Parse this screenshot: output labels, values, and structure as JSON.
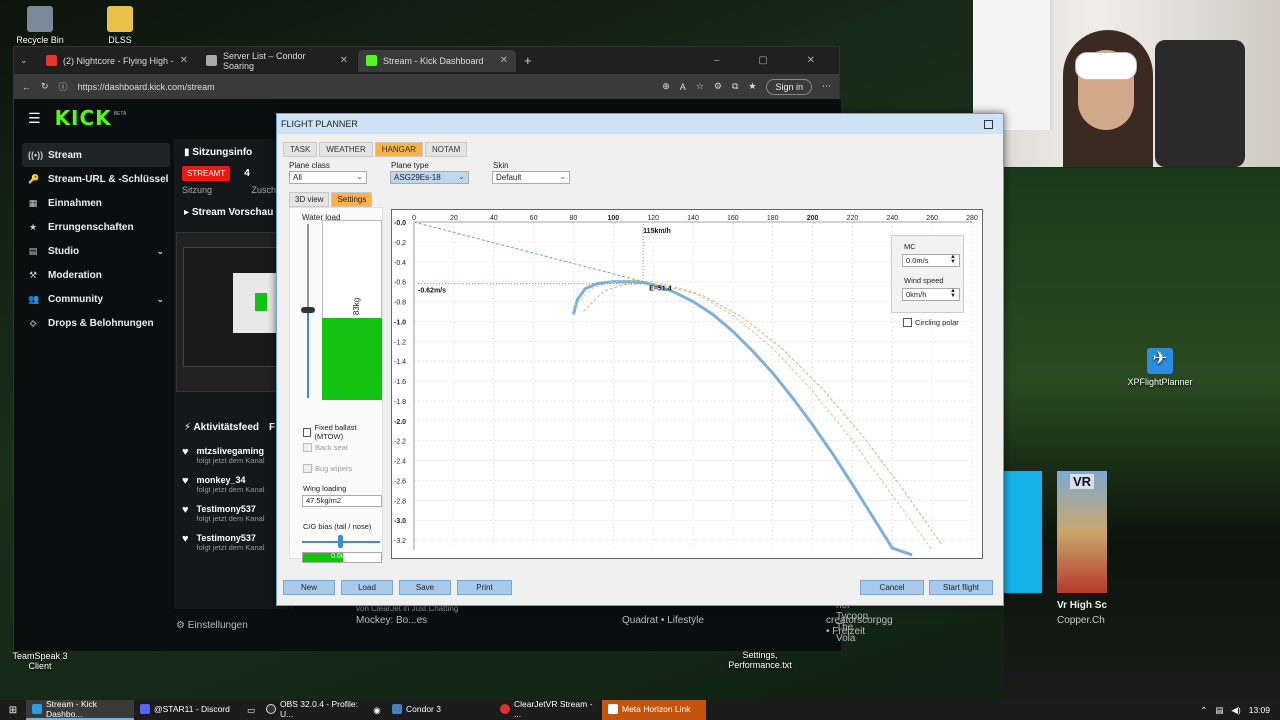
{
  "desktop": {
    "icons": [
      {
        "label": "Recycle Bin"
      },
      {
        "label": "DLSS"
      },
      {
        "label": "XPFlightPlanner"
      },
      {
        "label": "TeamSpeak 3 Client"
      },
      {
        "label": "Settings, Performance.txt"
      }
    ]
  },
  "browser": {
    "tabs": [
      {
        "label": "(2) Nightcore - Flying High -"
      },
      {
        "label": "Server List – Condor Soaring"
      },
      {
        "label": "Stream - Kick Dashboard"
      }
    ],
    "new_tab": "+",
    "url": "https://dashboard.kick.com/stream",
    "signin": "Sign in"
  },
  "kick": {
    "logo": "KICK",
    "logo_badge": "BETA",
    "nav": [
      {
        "label": "Stream",
        "icon": "((•))"
      },
      {
        "label": "Stream-URL & -Schlüssel",
        "icon": "🔑"
      },
      {
        "label": "Einnahmen",
        "icon": "▦"
      },
      {
        "label": "Errungenschaften",
        "icon": "★"
      },
      {
        "label": "Studio",
        "icon": "▤"
      },
      {
        "label": "Moderation",
        "icon": "⚒"
      },
      {
        "label": "Community",
        "icon": "👥"
      },
      {
        "label": "Drops & Belohnungen",
        "icon": "⬦"
      }
    ],
    "session_title": "Sitzungsinfo",
    "status_badge": "STREAMT",
    "viewers": "4",
    "session_label": "Sitzung",
    "viewers_label": "Zuschau",
    "preview_title": "Stream Vorschau",
    "activity_title": "Aktivitätsfeed",
    "activity_tab": "F",
    "feed": [
      {
        "name": "mtzslivegaming",
        "sub": "folgt jetzt dem Kanal"
      },
      {
        "name": "monkey_34",
        "sub": "folgt jetzt dem Kanal"
      },
      {
        "name": "Testimony537",
        "sub": "folgt jetzt dem Kanal"
      },
      {
        "name": "Testimony537",
        "sub": "folgt jetzt dem Kanal"
      }
    ],
    "settings_label": "Einstellungen",
    "bottom_items": [
      {
        "text": "von ClearJet in Just Chatting"
      },
      {
        "text": "Mockey: Bo...es"
      },
      {
        "text": "Quadrat • Lifestyle"
      },
      {
        "text": "her Tycoon The Vola"
      },
      {
        "text": "creatorscorpgg • Freizeit"
      }
    ]
  },
  "right_side": {
    "vr_title": "Vr High Sc",
    "vr_channel": "Copper.Ch",
    "vr_badge": "VR"
  },
  "flight_planner": {
    "title": "FLIGHT PLANNER",
    "tabs": [
      "TASK",
      "WEATHER",
      "HANGAR",
      "NOTAM"
    ],
    "active_tab": "HANGAR",
    "plane_class_label": "Plane class",
    "plane_class_value": "All",
    "plane_type_label": "Plane type",
    "plane_type_value": "ASG29Es-18",
    "skin_label": "Skin",
    "skin_value": "Default",
    "subtabs": [
      "3D view",
      "Settings"
    ],
    "active_subtab": "Settings",
    "water_load_label": "Water load",
    "water_kg": "83kg",
    "water_fraction": 0.46,
    "fixed_ballast": "Fixed ballast (MTOW)",
    "back_seat": "Back seat",
    "bug_wipers": "Bug wipers",
    "wing_loading_label": "Wing loading",
    "wing_loading_value": "47.5kg/m2",
    "cg_label": "C/G bias (tail / nose)",
    "cg_value": "0.0cm",
    "mc_label": "MC",
    "mc_value": "0.0m/s",
    "wind_label": "Wind speed",
    "wind_value": "0km/h",
    "circling_polar": "Circling polar",
    "buttons": [
      "New",
      "Load",
      "Save",
      "Print",
      "Cancel",
      "Start flight"
    ]
  },
  "chart_data": {
    "type": "line",
    "title": "",
    "xlabel": "",
    "ylabel": "",
    "xlim": [
      0,
      280
    ],
    "ylim": [
      -3.3,
      0
    ],
    "x_ticks": [
      "0",
      "20",
      "40",
      "60",
      "80",
      "100",
      "120",
      "140",
      "160",
      "180",
      "200",
      "220",
      "240",
      "260",
      "280"
    ],
    "y_ticks": [
      "-0.0",
      "-0.2",
      "-0.4",
      "-0.6",
      "-0.8",
      "-1.0",
      "-1.2",
      "-1.4",
      "-1.6",
      "-1.8",
      "-2.0",
      "-2.2",
      "-2.4",
      "-2.6",
      "-2.8",
      "-3.0",
      "-3.2"
    ],
    "annotations": [
      {
        "text": "115km/h",
        "x": 115,
        "y": -0.02
      },
      {
        "text": "-0.62m/s",
        "x": 2,
        "y": -0.62
      },
      {
        "text": "E=51.4",
        "x": 118,
        "y": -0.6
      }
    ],
    "series": [
      {
        "color": "#7fb0db",
        "x": [
          80,
          82,
          86,
          92,
          100,
          110,
          115,
          120,
          130,
          140,
          150,
          160,
          170,
          180,
          190,
          200,
          210,
          220,
          230,
          240,
          250
        ],
        "y": [
          -0.93,
          -0.78,
          -0.67,
          -0.62,
          -0.6,
          -0.6,
          -0.61,
          -0.63,
          -0.7,
          -0.8,
          -0.93,
          -1.1,
          -1.3,
          -1.52,
          -1.77,
          -2.04,
          -2.33,
          -2.64,
          -2.96,
          -3.28,
          -3.35
        ]
      },
      {
        "color": "#c8c878",
        "x": [
          80,
          90,
          100,
          110,
          120,
          140,
          160,
          180,
          200,
          220,
          240,
          260
        ],
        "y": [
          -0.85,
          -0.66,
          -0.6,
          -0.59,
          -0.6,
          -0.7,
          -0.94,
          -1.27,
          -1.7,
          -2.2,
          -2.75,
          -3.3
        ]
      },
      {
        "color": "#e0a070",
        "x": [
          85,
          95,
          105,
          115,
          125,
          145,
          165,
          185,
          205,
          225,
          245,
          265
        ],
        "y": [
          -0.9,
          -0.7,
          -0.63,
          -0.62,
          -0.64,
          -0.74,
          -0.96,
          -1.28,
          -1.68,
          -2.15,
          -2.68,
          -3.25
        ]
      },
      {
        "color": "#6aa86a",
        "x": [
          0,
          115
        ],
        "y": [
          0,
          -0.6
        ]
      }
    ],
    "grid": true
  }
}
